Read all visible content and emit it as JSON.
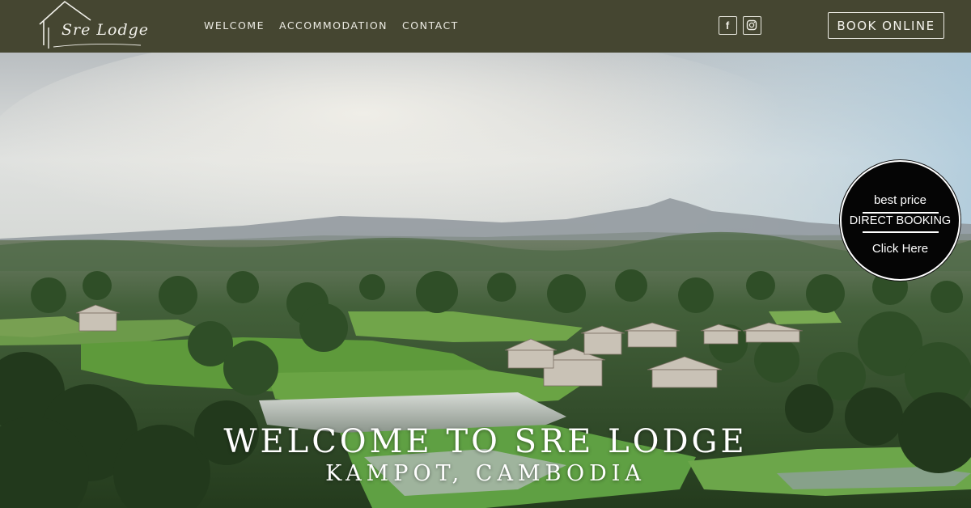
{
  "header": {
    "logo_text": "Sre Lodge",
    "nav": [
      "WELCOME",
      "ACCOMMODATION",
      "CONTACT"
    ],
    "social": [
      {
        "icon": "facebook-icon",
        "label": "f"
      },
      {
        "icon": "instagram-icon"
      }
    ],
    "book_label": "BOOK ONLINE"
  },
  "badge": {
    "line1": "best price",
    "line2": "DIRECT BOOKING",
    "line3": "Click Here"
  },
  "hero": {
    "title": "WELCOME TO SRE LODGE",
    "subtitle": "KAMPOT, CAMBODIA"
  },
  "colors": {
    "header_bg": "#454631",
    "text_light": "#ecebe3",
    "badge_bg": "#050505"
  }
}
